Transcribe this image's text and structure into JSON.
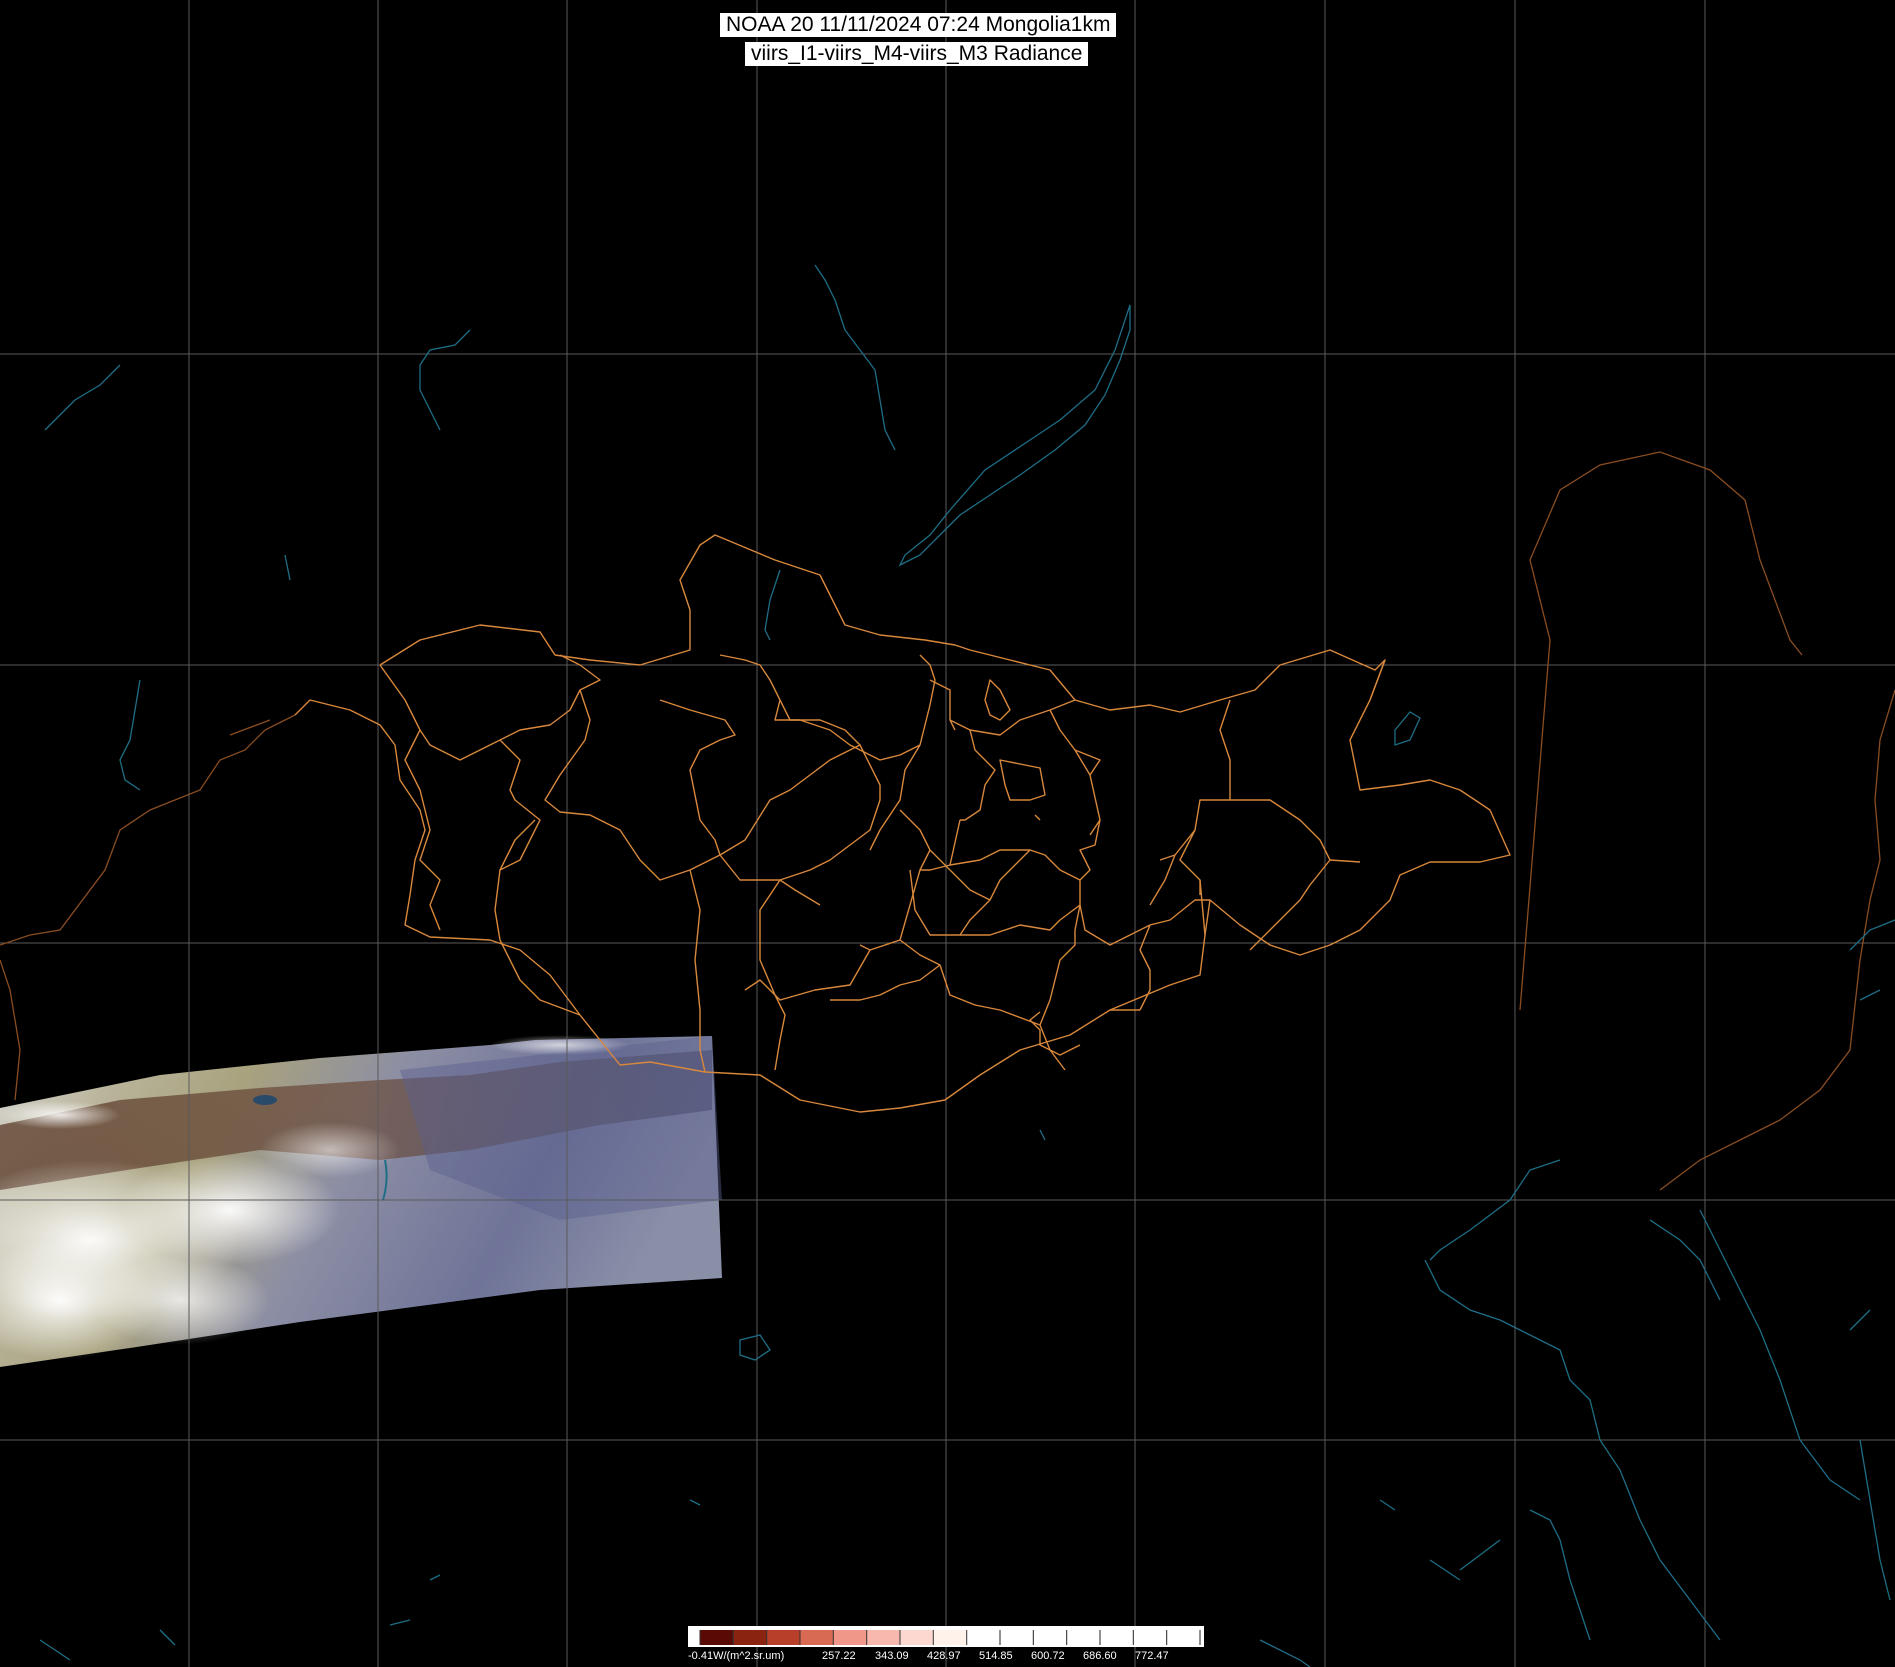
{
  "header": {
    "line1": "NOAA 20 11/11/2024 07:24 Mongolia1km",
    "line2": "viirs_I1-viirs_M4-viirs_M3 Radiance"
  },
  "colors": {
    "background": "#000000",
    "grid": "#5a5a5a",
    "coast_lakes": "#1e6e86",
    "national_border": "#8a4d22",
    "admin_border": "#d8883c"
  },
  "colorbar": {
    "unit_label": "-0.41W/(m^2.sr.um)",
    "tick_labels": [
      "257.22",
      "343.09",
      "428.97",
      "514.85",
      "600.72",
      "686.60",
      "772.47"
    ],
    "colors": [
      "#5a0a04",
      "#8a2410",
      "#b8402a",
      "#d86a54",
      "#f0978a",
      "#f8b8ae",
      "#fdd8d0",
      "#fff2ea",
      "#ffffff",
      "#ffffff",
      "#ffffff",
      "#ffffff",
      "#ffffff",
      "#ffffff",
      "#ffffff"
    ]
  }
}
